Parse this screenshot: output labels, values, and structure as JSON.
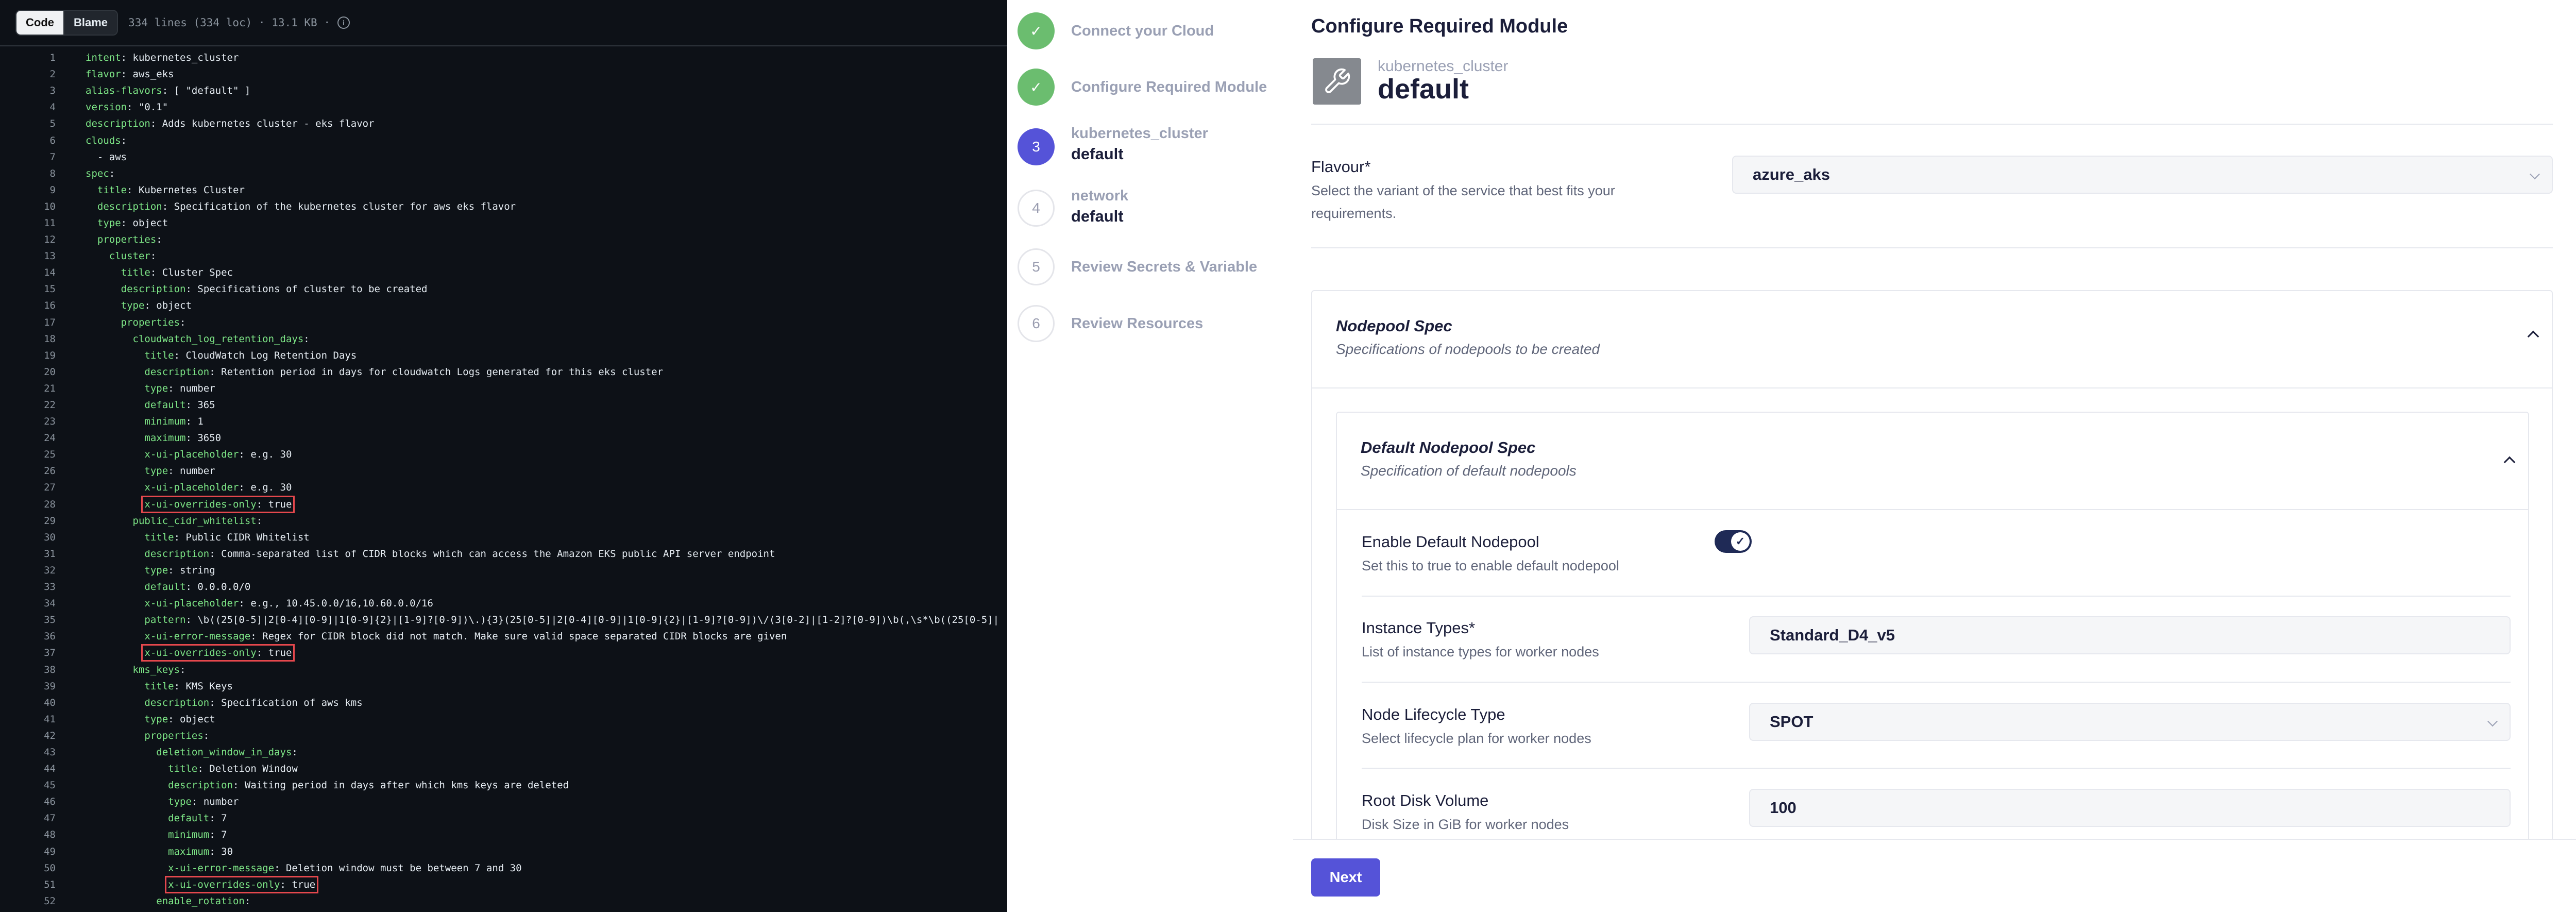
{
  "code_view": {
    "tab_code": "Code",
    "tab_blame": "Blame",
    "file_info": "334 lines (334 loc) · 13.1 KB ·",
    "info_icon": "info-icon",
    "lines": [
      {
        "num": "1",
        "ind": "",
        "key": "intent",
        "val": " kubernetes_cluster",
        "hl": false
      },
      {
        "num": "2",
        "ind": "",
        "key": "flavor",
        "val": " aws_eks",
        "hl": false
      },
      {
        "num": "3",
        "ind": "",
        "key": "alias-flavors",
        "val": " [ \"default\" ]",
        "hl": false
      },
      {
        "num": "4",
        "ind": "",
        "key": "version",
        "val": " \"0.1\"",
        "hl": false
      },
      {
        "num": "5",
        "ind": "",
        "key": "description",
        "val": " Adds kubernetes cluster - eks flavor",
        "hl": false
      },
      {
        "num": "6",
        "ind": "",
        "key": "clouds",
        "val": "",
        "hl": false
      },
      {
        "num": "7",
        "ind": "  - aws",
        "key": "",
        "val": "",
        "hl": false
      },
      {
        "num": "8",
        "ind": "",
        "key": "spec",
        "val": "",
        "hl": false
      },
      {
        "num": "9",
        "ind": "  ",
        "key": "title",
        "val": " Kubernetes Cluster",
        "hl": false
      },
      {
        "num": "10",
        "ind": "  ",
        "key": "description",
        "val": " Specification of the kubernetes cluster for aws eks flavor",
        "hl": false
      },
      {
        "num": "11",
        "ind": "  ",
        "key": "type",
        "val": " object",
        "hl": false
      },
      {
        "num": "12",
        "ind": "  ",
        "key": "properties",
        "val": "",
        "hl": false
      },
      {
        "num": "13",
        "ind": "    ",
        "key": "cluster",
        "val": "",
        "hl": false
      },
      {
        "num": "14",
        "ind": "      ",
        "key": "title",
        "val": " Cluster Spec",
        "hl": false
      },
      {
        "num": "15",
        "ind": "      ",
        "key": "description",
        "val": " Specifications of cluster to be created",
        "hl": false
      },
      {
        "num": "16",
        "ind": "      ",
        "key": "type",
        "val": " object",
        "hl": false
      },
      {
        "num": "17",
        "ind": "      ",
        "key": "properties",
        "val": "",
        "hl": false
      },
      {
        "num": "18",
        "ind": "        ",
        "key": "cloudwatch_log_retention_days",
        "val": "",
        "hl": false
      },
      {
        "num": "19",
        "ind": "          ",
        "key": "title",
        "val": " CloudWatch Log Retention Days",
        "hl": false
      },
      {
        "num": "20",
        "ind": "          ",
        "key": "description",
        "val": " Retention period in days for cloudwatch Logs generated for this eks cluster",
        "hl": false
      },
      {
        "num": "21",
        "ind": "          ",
        "key": "type",
        "val": " number",
        "hl": false
      },
      {
        "num": "22",
        "ind": "          ",
        "key": "default",
        "val": " 365",
        "hl": false
      },
      {
        "num": "23",
        "ind": "          ",
        "key": "minimum",
        "val": " 1",
        "hl": false
      },
      {
        "num": "24",
        "ind": "          ",
        "key": "maximum",
        "val": " 3650",
        "hl": false
      },
      {
        "num": "25",
        "ind": "          ",
        "key": "x-ui-placeholder",
        "val": " e.g. 30",
        "hl": false
      },
      {
        "num": "26",
        "ind": "          ",
        "key": "type",
        "val": " number",
        "hl": false
      },
      {
        "num": "27",
        "ind": "          ",
        "key": "x-ui-placeholder",
        "val": " e.g. 30",
        "hl": false
      },
      {
        "num": "28",
        "ind": "          ",
        "key": "x-ui-overrides-only",
        "val": " true",
        "hl": true
      },
      {
        "num": "29",
        "ind": "        ",
        "key": "public_cidr_whitelist",
        "val": "",
        "hl": false
      },
      {
        "num": "30",
        "ind": "          ",
        "key": "title",
        "val": " Public CIDR Whitelist",
        "hl": false
      },
      {
        "num": "31",
        "ind": "          ",
        "key": "description",
        "val": " Comma-separated list of CIDR blocks which can access the Amazon EKS public API server endpoint",
        "hl": false
      },
      {
        "num": "32",
        "ind": "          ",
        "key": "type",
        "val": " string",
        "hl": false
      },
      {
        "num": "33",
        "ind": "          ",
        "key": "default",
        "val": " 0.0.0.0/0",
        "hl": false
      },
      {
        "num": "34",
        "ind": "          ",
        "key": "x-ui-placeholder",
        "val": " e.g., 10.45.0.0/16,10.60.0.0/16",
        "hl": false
      },
      {
        "num": "35",
        "ind": "          ",
        "key": "pattern",
        "val": " \\b((25[0-5]|2[0-4][0-9]|1[0-9]{2}|[1-9]?[0-9])\\.){3}(25[0-5]|2[0-4][0-9]|1[0-9]{2}|[1-9]?[0-9])\\/(3[0-2]|[1-2]?[0-9])\\b(,\\s*\\b((25[0-5]|",
        "hl": false
      },
      {
        "num": "36",
        "ind": "          ",
        "key": "x-ui-error-message",
        "val": " Regex for CIDR block did not match. Make sure valid space separated CIDR blocks are given",
        "hl": false
      },
      {
        "num": "37",
        "ind": "          ",
        "key": "x-ui-overrides-only",
        "val": " true",
        "hl": true
      },
      {
        "num": "38",
        "ind": "        ",
        "key": "kms_keys",
        "val": "",
        "hl": false
      },
      {
        "num": "39",
        "ind": "          ",
        "key": "title",
        "val": " KMS Keys",
        "hl": false
      },
      {
        "num": "40",
        "ind": "          ",
        "key": "description",
        "val": " Specification of aws kms",
        "hl": false
      },
      {
        "num": "41",
        "ind": "          ",
        "key": "type",
        "val": " object",
        "hl": false
      },
      {
        "num": "42",
        "ind": "          ",
        "key": "properties",
        "val": "",
        "hl": false
      },
      {
        "num": "43",
        "ind": "            ",
        "key": "deletion_window_in_days",
        "val": "",
        "hl": false
      },
      {
        "num": "44",
        "ind": "              ",
        "key": "title",
        "val": " Deletion Window",
        "hl": false
      },
      {
        "num": "45",
        "ind": "              ",
        "key": "description",
        "val": " Waiting period in days after which kms keys are deleted",
        "hl": false
      },
      {
        "num": "46",
        "ind": "              ",
        "key": "type",
        "val": " number",
        "hl": false
      },
      {
        "num": "47",
        "ind": "              ",
        "key": "default",
        "val": " 7",
        "hl": false
      },
      {
        "num": "48",
        "ind": "              ",
        "key": "minimum",
        "val": " 7",
        "hl": false
      },
      {
        "num": "49",
        "ind": "              ",
        "key": "maximum",
        "val": " 30",
        "hl": false
      },
      {
        "num": "50",
        "ind": "              ",
        "key": "x-ui-error-message",
        "val": " Deletion window must be between 7 and 30",
        "hl": false
      },
      {
        "num": "51",
        "ind": "              ",
        "key": "x-ui-overrides-only",
        "val": " true",
        "hl": true
      },
      {
        "num": "52",
        "ind": "            ",
        "key": "enable_rotation",
        "val": "",
        "hl": false
      }
    ]
  },
  "stepper": {
    "steps": [
      {
        "marker": "✓",
        "title": "Connect your Cloud",
        "sub": ""
      },
      {
        "marker": "✓",
        "title": "Configure Required Module",
        "sub": ""
      },
      {
        "marker": "3",
        "title": "kubernetes_cluster",
        "sub": "default"
      },
      {
        "marker": "4",
        "title": "network",
        "sub": "default"
      },
      {
        "marker": "5",
        "title": "Review Secrets & Variable",
        "sub": ""
      },
      {
        "marker": "6",
        "title": "Review Resources",
        "sub": ""
      }
    ]
  },
  "config": {
    "title": "Configure Required Module",
    "module_icon": "wrench-icon",
    "module_type": "kubernetes_cluster",
    "module_name": "default",
    "flavour": {
      "label": "Flavour*",
      "description": "Select the variant of the service that best fits your requirements.",
      "value": "azure_aks"
    },
    "nodepool_spec": {
      "title": "Nodepool Spec",
      "description": "Specifications of nodepools to be created"
    },
    "default_nodepool_spec": {
      "title": "Default Nodepool Spec",
      "description": "Specification of default nodepools"
    },
    "enable_default_nodepool": {
      "label": "Enable Default Nodepool",
      "description": "Set this to true to enable default nodepool",
      "value": true
    },
    "instance_types": {
      "label": "Instance Types*",
      "description": "List of instance types for worker nodes",
      "value": "Standard_D4_v5"
    },
    "node_lifecycle_type": {
      "label": "Node Lifecycle Type",
      "description": "Select lifecycle plan for worker nodes",
      "value": "SPOT"
    },
    "root_disk_volume": {
      "label": "Root Disk Volume",
      "description": "Disk Size in GiB for worker nodes",
      "value": "100"
    },
    "next_label": "Next"
  },
  "colors": {
    "code_bg": "#0d1117",
    "key_green": "#7ee787",
    "highlight_red": "#e5484d",
    "step_done": "#6bbd6f",
    "accent": "#5553d8"
  }
}
